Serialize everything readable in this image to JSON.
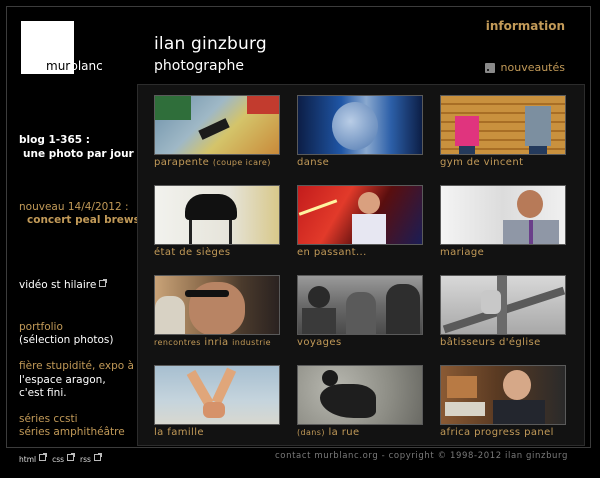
{
  "logo": {
    "mur": "mur",
    "blanc": "blanc"
  },
  "header": {
    "title": "ilan ginzburg",
    "subtitle": "photographe",
    "info_link": "information",
    "news_link": "nouveautés"
  },
  "sidebar": {
    "blog_line1": "blog 1-365 :",
    "blog_line2": "une photo par jour",
    "news_date": "nouveau 14/4/2012 :",
    "news_title": "concert peal brews",
    "video": "vidéo st hilaire",
    "portfolio": "portfolio",
    "portfolio_sub": "(sélection photos)",
    "expo_line1": "fière stupidité, expo à",
    "expo_line2": "l'espace aragon,",
    "expo_line3": "c'est fini.",
    "series_ccsti": "séries ccsti",
    "series_amphi": "séries amphithéâtre"
  },
  "gallery": [
    {
      "caption": "parapente",
      "note": "(coupe icare)"
    },
    {
      "caption": "danse"
    },
    {
      "caption": "gym de vincent"
    },
    {
      "caption": "état de sièges"
    },
    {
      "caption": "en passant..."
    },
    {
      "caption": "mariage"
    },
    {
      "caption": "inria",
      "pre": "rencontres",
      "note": "industrie"
    },
    {
      "caption": "voyages"
    },
    {
      "caption": "bâtisseurs d'église"
    },
    {
      "caption": "la famille"
    },
    {
      "caption": "la rue",
      "pre": "(dans)"
    },
    {
      "caption": "africa progress panel"
    }
  ],
  "footer": {
    "links": [
      "html",
      "css",
      "rss"
    ],
    "copyright": "contact murblanc.org - copyright © 1998-2012 ilan ginzburg"
  },
  "colors": {
    "accent": "#c29a58",
    "background": "#000000"
  }
}
